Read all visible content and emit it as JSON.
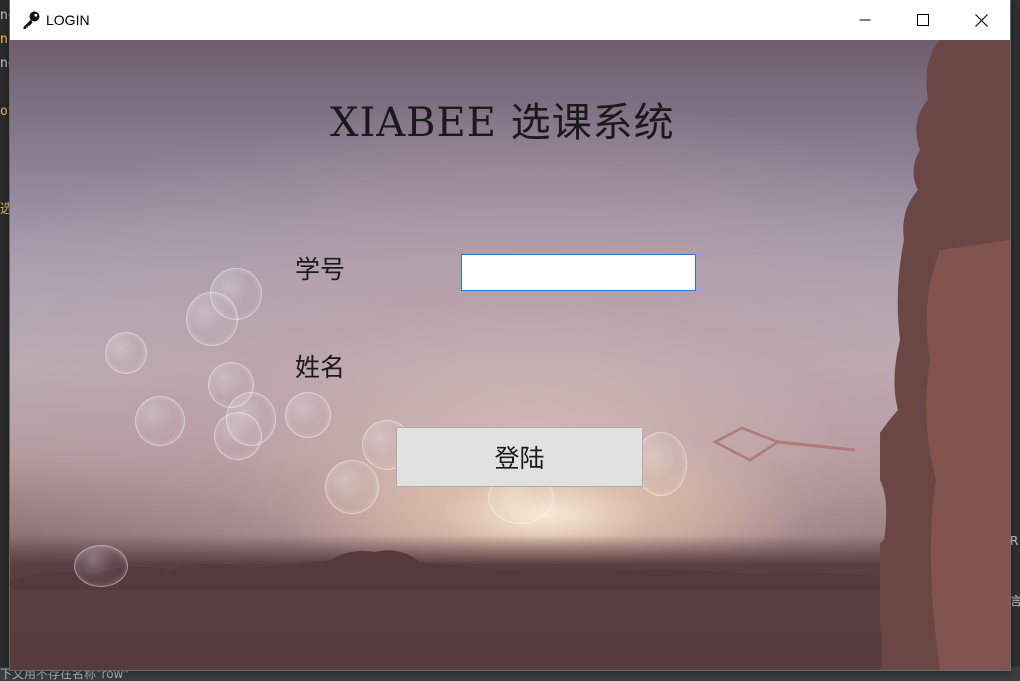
{
  "window": {
    "title": "LOGIN",
    "title_icon": "key-icon",
    "controls": {
      "minimize_icon": "minimize-icon",
      "maximize_icon": "maximize-icon",
      "close_icon": "close-icon"
    }
  },
  "form": {
    "heading": "XIABEE 选课系统",
    "student_id_label": "学号",
    "student_id_value": "",
    "name_label": "姓名",
    "login_button": "登陆"
  },
  "background_editor": {
    "fragments": [
      "ne",
      "n(",
      "ne",
      "ov",
      "选"
    ],
    "right_fragments": [
      "R",
      "言"
    ],
    "bottom_text": "下文用不存在名称\"row\""
  },
  "colors": {
    "input_border": "#1e7ad4",
    "button_bg": "#e1e1e1",
    "button_border": "#adadad",
    "titlebar_bg": "#ffffff"
  }
}
